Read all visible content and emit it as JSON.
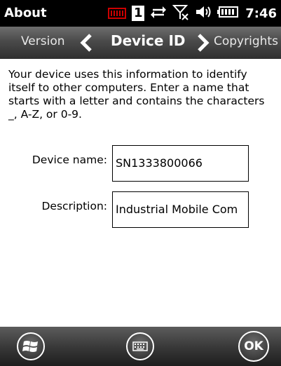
{
  "status_bar": {
    "title": "About",
    "one_indicator": "1",
    "time": "7:46",
    "icons": [
      "sim-card-icon",
      "data-sync-icon",
      "no-signal-icon",
      "speaker-icon",
      "battery-icon"
    ]
  },
  "nav": {
    "prev_label": "Version",
    "current_label": "Device ID",
    "next_label": "Copyrights"
  },
  "content": {
    "intro": "Your device uses this information to identify itself to other computers. Enter a name that starts with a letter and contains the characters _, A-Z, or 0-9.",
    "device_name_label": "Device name:",
    "device_name_value": "SN1333800066",
    "description_label": "Description:",
    "description_value": "Industrial Mobile Com"
  },
  "bottom_bar": {
    "ok_label": "OK",
    "icons": [
      "windows-start-icon",
      "keyboard-icon"
    ]
  }
}
